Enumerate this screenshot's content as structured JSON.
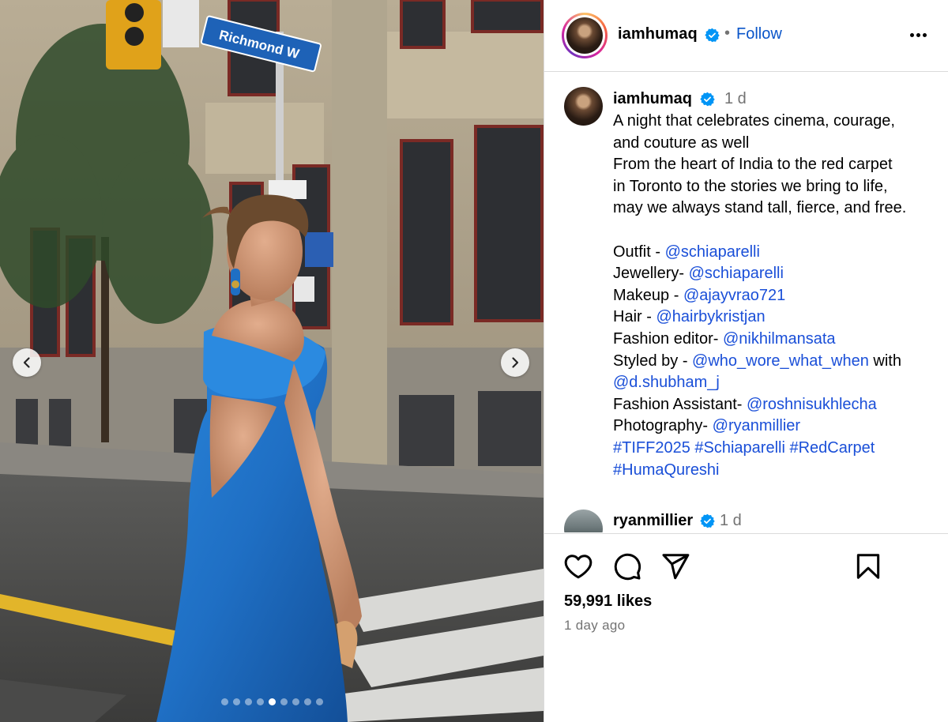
{
  "post": {
    "username": "iamhumaq",
    "separator": "•",
    "follow_label": "Follow",
    "more_icon": "more-horizontal-icon",
    "carousel": {
      "slide_count": 9,
      "active_slide": 5
    },
    "street_sign": "Richmond W"
  },
  "caption": {
    "username": "iamhumaq",
    "time": "1 d",
    "lines": [
      "A night that celebrates cinema, courage,",
      "and couture as well",
      "From the heart of India to the red carpet",
      "in Toronto to the stories we bring to life,",
      "may we always stand tall, fierce, and free."
    ],
    "credits": [
      {
        "label": "Outfit - ",
        "handle": "@schiaparelli"
      },
      {
        "label": "Jewellery- ",
        "handle": "@schiaparelli"
      },
      {
        "label": "Makeup - ",
        "handle": "@ajayvrao721"
      },
      {
        "label": "Hair - ",
        "handle": "@hairbykristjan"
      },
      {
        "label": "Fashion editor- ",
        "handle": "@nikhilmansata"
      },
      {
        "label": "Styled by - ",
        "handle": "@who_wore_what_when",
        "suffix": " with"
      },
      {
        "label": "",
        "handle": "@d.shubham_j"
      },
      {
        "label": "Fashion Assistant- ",
        "handle": "@roshnisukhlecha"
      },
      {
        "label": "Photography- ",
        "handle": "@ryanmillier"
      }
    ],
    "hashtags_line1": [
      "#TIFF2025",
      "#Schiaparelli",
      "#RedCarpet"
    ],
    "hashtags_line2": [
      "#HumaQureshi"
    ]
  },
  "comment": {
    "username": "ryanmillier",
    "time": "1 d"
  },
  "footer": {
    "likes": "59,991 likes",
    "when": "1 day ago",
    "icons": [
      "heart-icon",
      "comment-icon",
      "share-icon",
      "bookmark-icon"
    ]
  },
  "colors": {
    "link": "#1a4fd8",
    "follow": "#0a55c9",
    "verified": "#0095f6",
    "muted": "#737373",
    "dress": "#1f6fc4"
  }
}
